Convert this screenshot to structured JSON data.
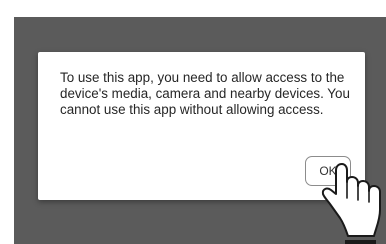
{
  "dialog": {
    "message": "To use this app, you need to allow access to the device's media, camera and nearby devices. You cannot use this app without allowing access.",
    "ok_label": "OK"
  },
  "overlay": {
    "gesture_icon": "tap-hand-icon"
  },
  "colors": {
    "backdrop": "#5b5b5b",
    "dialog_background": "#ffffff",
    "text": "#262626",
    "button_border": "#8c8c8c"
  }
}
